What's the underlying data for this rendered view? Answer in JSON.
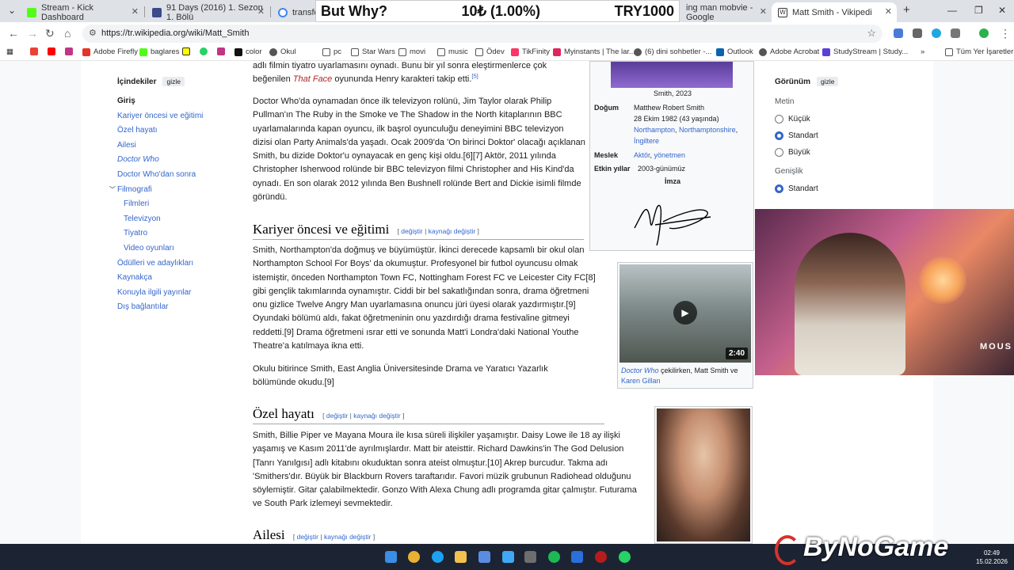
{
  "tabs": [
    {
      "title": "Stream - Kick Dashboard",
      "color": "#53fc18"
    },
    {
      "title": "91 Days (2016) 1. Sezon 1. Bölü",
      "color": "#3b4a8c"
    },
    {
      "title": "transform",
      "color": "#ffffff"
    },
    {
      "title": "ing man mobvie - Google",
      "color": "#ffffff"
    },
    {
      "title": "Matt Smith - Vikipedi",
      "color": "#ffffff"
    }
  ],
  "overlay": {
    "left": "But Why?",
    "center": "10₺ (1.00%)",
    "right": "TRY1000"
  },
  "address": {
    "url": "https://tr.wikipedia.org/wiki/Matt_Smith"
  },
  "bookmarks": [
    "Adobe Firefly",
    "baglares",
    "color",
    "Okul",
    "pc",
    "Star Wars",
    "movi",
    "music",
    "Ödev",
    "TikFinity",
    "Myinstants | The lar...",
    "(6) dini sohbetler -...",
    "Outlook",
    "Adobe Acrobat",
    "StudyStream | Study...",
    "Tüm Yer İşaretleri"
  ],
  "toc": {
    "title": "İçindekiler",
    "hide": "gizle",
    "items": [
      "Giriş",
      "Kariyer öncesi ve eğitimi",
      "Özel hayatı",
      "Ailesi",
      "Doctor Who",
      "Doctor Who'dan sonra",
      "Filmografi",
      "Filmleri",
      "Televizyon",
      "Tiyatro",
      "Video oyunları",
      "Ödülleri ve adaylıkları",
      "Kaynakça",
      "Konuyla ilgili yayınlar",
      "Dış bağlantılar"
    ]
  },
  "appearance": {
    "title": "Görünüm",
    "hide": "gizle",
    "text_label": "Metin",
    "opt_small": "Küçük",
    "opt_standard": "Standart",
    "opt_large": "Büyük",
    "width_label": "Genişlik",
    "width_standard": "Standart"
  },
  "infobox": {
    "caption": "Smith, 2023",
    "born_label": "Doğum",
    "born_name": "Matthew Robert Smith",
    "born_date": "28 Ekim 1982 (43 yaşında)",
    "born_place_1": "Northampton",
    "born_place_2": "Northamptonshire",
    "born_place_3": "İngiltere",
    "job_label": "Meslek",
    "job_1": "Aktör",
    "job_2": "yönetmen",
    "years_label": "Etkin yıllar",
    "years": "2003-günümüz",
    "sign_label": "İmza"
  },
  "video": {
    "duration": "2:40",
    "cap_1": "Doctor Who",
    "cap_2": " çekilirken, Matt Smith ve ",
    "cap_3": "Karen Gillan"
  },
  "sections": {
    "career": "Kariyer öncesi ve eğitimi",
    "private": "Özel hayatı",
    "family": "Ailesi",
    "edit": "değiştir",
    "edit_src": "kaynağı değiştir"
  },
  "text": {
    "top_a": "adlı filmin tiyatro uyarlamasını oynadı. Bunu bir yıl sonra eleştirmenlerce çok beğenilen ",
    "top_b": "That Face",
    "top_c": " oyununda Henry karakteri takip etti.",
    "p1": "Doctor Who'da oynamadan önce ilk televizyon rolünü, Jim Taylor olarak Philip Pullman'ın The Ruby in the Smoke ve The Shadow in the North kitaplarının BBC uyarlamalarında kapan oyuncu, ilk başrol oyunculuğu deneyimini BBC televizyon dizisi olan Party Animals'da yaşadı. Ocak 2009'da 'On birinci Doktor' olacağı açıklanan Smith, bu dizide Doktor'u oynayacak en genç kişi oldu.[6][7] Aktör, 2011 yılında Christopher Isherwood rolünde bir BBC televizyon filmi Christopher and His Kind'da oynadı. En son olarak 2012 yılında Ben Bushnell rolünde Bert and Dickie isimli filmde göründü.",
    "p2": "Smith, Northampton'da doğmuş ve büyümüştür. İkinci derecede kapsamlı bir okul olan Northampton School For Boys' da okumuştur. Profesyonel bir futbol oyuncusu olmak istemiştir, önceden Northampton Town FC, Nottingham Forest FC ve Leicester City FC[8] gibi gençlik takımlarında oynamıştır. Ciddi bir bel sakatlığından sonra, drama öğretmeni onu gizlice Twelve Angry Man uyarlamasına onuncu jüri üyesi olarak yazdırmıştır.[9] Oyundaki bölümü aldı, fakat öğretmeninin onu yazdırdığı drama festivaline gitmeyi reddetti.[9] Drama öğretmeni ısrar etti ve sonunda Matt'i Londra'daki National Youthe Theatre'a katılmaya ikna etti.",
    "p3": "Okulu bitirince Smith, East Anglia Üniversitesinde Drama ve Yaratıcı Yazarlık bölümünde okudu.[9]",
    "p4": "Smith, Billie Piper ve Mayana Moura ile kısa süreli ilişkiler yaşamıştır. Daisy Lowe ile 18 ay ilişki yaşamış ve Kasım 2011'de ayrılmışlardır. Matt bir ateisttir. Richard Dawkins'in The God Delusion [Tanrı Yanılgısı] adlı kitabını okuduktan sonra ateist olmuştur.[10] Akrep burcudur. Takma adı 'Smithers'dır. Büyük bir Blackburn Rovers taraftarıdır. Favori müzik grubunun Radiohead olduğunu söylemiştir. Gitar çalabilmektedir. Gonzo With Alexa Chung adlı programda gitar çalmıştır. Futurama ve South Park izlemeyi sevmektedir."
  },
  "webcam": {
    "label": "MOUS"
  },
  "taskbar": {
    "time": "02:49",
    "date": "15.02.2026"
  },
  "watermark": "ByNoGame"
}
